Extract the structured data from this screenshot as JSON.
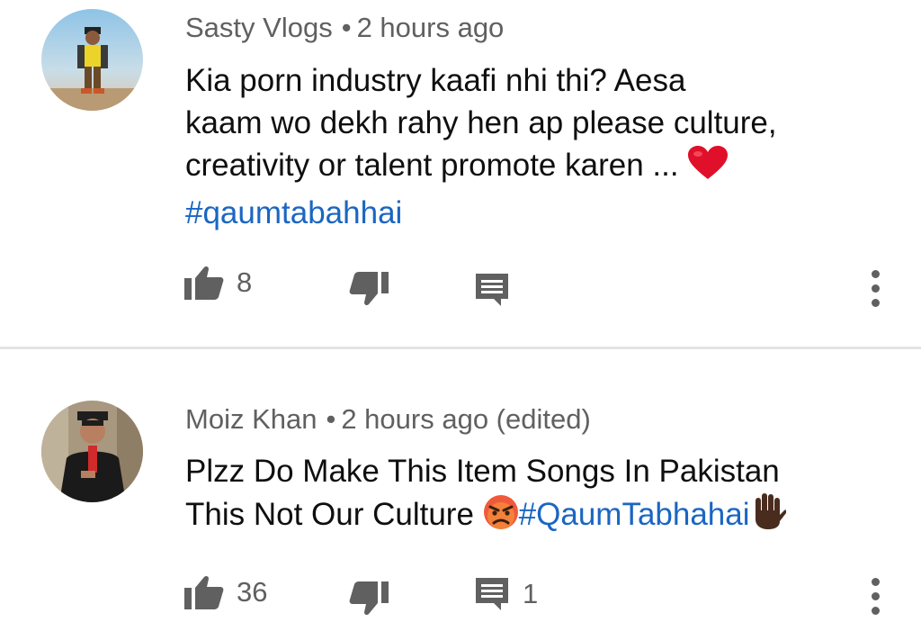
{
  "comments": [
    {
      "author": "Sasty Vlogs",
      "separator": "•",
      "time": "2 hours ago",
      "text_lines": [
        "Kia porn industry kaafi nhi thi? Aesa",
        "kaam wo dekh rahy hen ap please culture,",
        "creativity or talent promote karen ..."
      ],
      "hashtag": "#qaumtabahhai",
      "like_count": "8",
      "reply_count": "",
      "emoji": "red-heart"
    },
    {
      "author": "Moiz Khan",
      "separator": "•",
      "time": "2 hours ago (edited)",
      "text_lines": [
        "Plzz Do Make This Item Songs In Pakistan",
        "This Not Our Culture"
      ],
      "hashtag": "#QaumTabhahai",
      "like_count": "36",
      "reply_count": "1",
      "emoji": "angry-face"
    }
  ],
  "colors": {
    "text": "#0f0f0f",
    "meta": "#606060",
    "hashtag": "#1a66c2",
    "divider": "#e3e3e3",
    "icon": "#606060"
  },
  "icons": [
    "thumb-up-icon",
    "thumb-down-icon",
    "reply-icon",
    "more-vert-icon",
    "heart-emoji",
    "angry-emoji",
    "raised-hand-emoji"
  ]
}
